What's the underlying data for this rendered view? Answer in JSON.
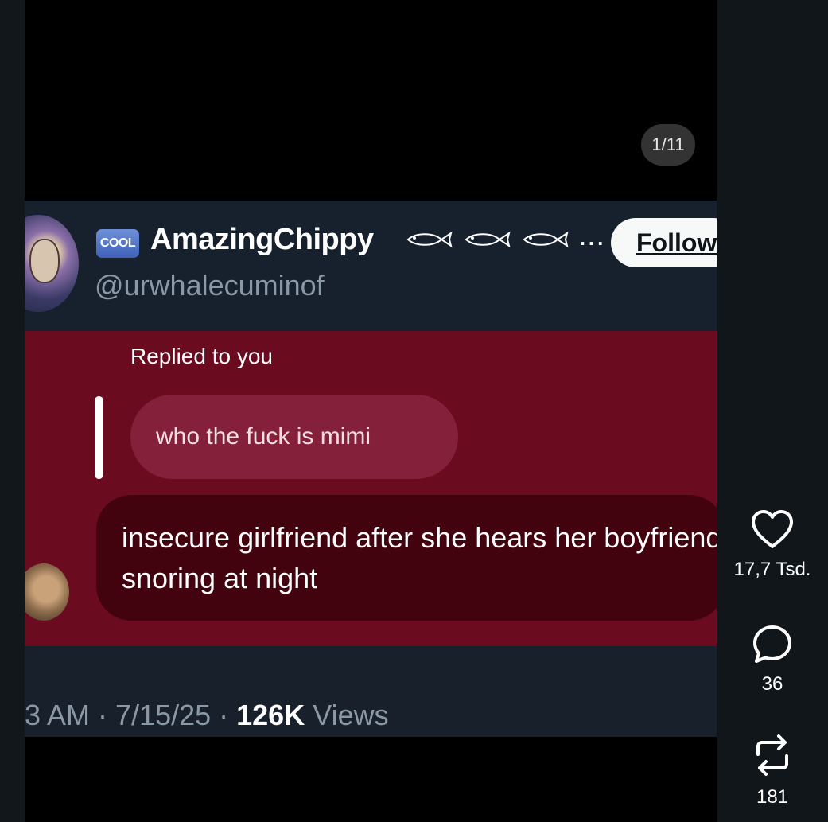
{
  "media": {
    "counter": "1/11"
  },
  "tweet": {
    "badge": "COOL",
    "display_name": "AmazingChippy",
    "name_suffix": "...",
    "handle": "@urwhalecuminof",
    "follow_label": "Follow",
    "replied_label": "Replied to you",
    "quoted_message": "who the fuck is mimi",
    "message": "insecure girlfriend after she hears her boyfriend snoring at night",
    "timestamp_prefix": "3 AM · 7/15/25 · ",
    "views_count": "126K",
    "views_label": " Views"
  },
  "actions": {
    "likes": "17,7 Tsd.",
    "comments": "36",
    "reposts": "181"
  },
  "icons": {
    "like": "heart-icon",
    "comment": "comment-bubble-icon",
    "repost": "repost-icon"
  }
}
